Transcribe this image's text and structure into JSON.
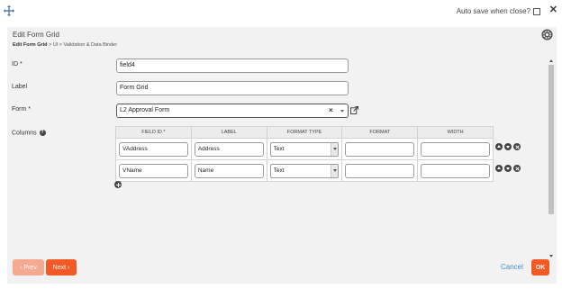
{
  "topbar": {
    "move_icon": "move-arrows-icon",
    "autosave_label": "Auto save when close?",
    "autosave_checked": false,
    "close_label": "✕"
  },
  "panel": {
    "title": "Edit Form Grid",
    "breadcrumb": {
      "current": "Edit Form Grid",
      "rest": " > UI > Validation & Data Binder"
    },
    "settings_icon": "gear-icon"
  },
  "form": {
    "id_label": "ID *",
    "id_value": "field4",
    "label_label": "Label",
    "label_value": "Form Grid",
    "form_label": "Form *",
    "form_value": "L2 Approval Form",
    "form_clear": "×",
    "columns_label": "Columns",
    "help_glyph": "?"
  },
  "grid": {
    "headers": [
      "FIELD ID *",
      "LABEL",
      "FORMAT TYPE",
      "FORMAT",
      "WIDTH"
    ],
    "rows": [
      {
        "field_id": "VAddress",
        "label": "Address",
        "format_type": "Text",
        "format": "",
        "width": ""
      },
      {
        "field_id": "VName",
        "label": "Name",
        "format_type": "Text",
        "format": "",
        "width": ""
      }
    ]
  },
  "footer": {
    "prev_label": "‹ Prev",
    "next_label": "Next ›",
    "cancel_label": "Cancel",
    "ok_label": "OK"
  },
  "colors": {
    "accent": "#f15a24",
    "accent_disabled": "#f4a990",
    "link": "#3a8fd1",
    "panel_bg": "#f2f2f2"
  }
}
